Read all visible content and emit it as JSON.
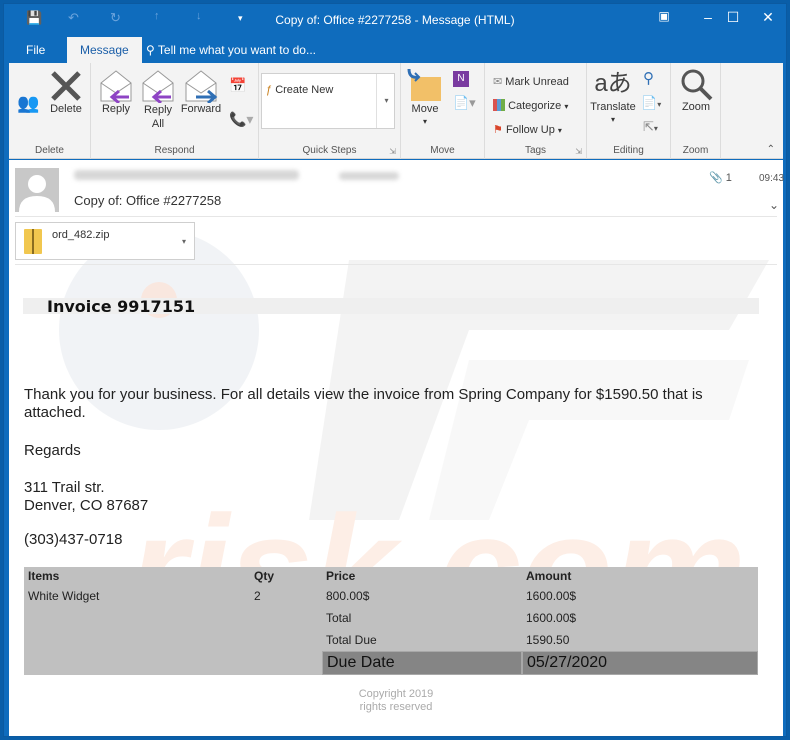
{
  "window": {
    "title": "Copy of: Office #2277258 - Message (HTML)",
    "quick_access": [
      "save-icon",
      "undo-icon",
      "redo-icon",
      "up-icon",
      "down-icon",
      "customize-icon"
    ],
    "controls": [
      "ribbon-display-icon",
      "minimize-icon",
      "maximize-icon",
      "close-icon"
    ]
  },
  "tabs": {
    "file": "File",
    "message": "Message",
    "tell_me": "Tell me what you want to do..."
  },
  "ribbon": {
    "groups": {
      "delete": "Delete",
      "respond": "Respond",
      "quick_steps": "Quick Steps",
      "move": "Move",
      "tags": "Tags",
      "editing": "Editing",
      "zoom": "Zoom"
    },
    "buttons": {
      "delete": "Delete",
      "reply": "Reply",
      "reply_all_1": "Reply",
      "reply_all_2": "All",
      "forward": "Forward",
      "create_new": "Create New",
      "move": "Move",
      "mark_unread": "Mark Unread",
      "categorize": "Categorize",
      "follow_up": "Follow Up",
      "translate": "Translate",
      "zoom": "Zoom"
    }
  },
  "message": {
    "subject": "Copy of: Office #2277258",
    "attachment_count": "1",
    "time": "09:43",
    "attachment": "ord_482.zip"
  },
  "body": {
    "invoice_title": "Invoice 9917151",
    "paragraph_1": "Thank you for your business. For all details view the invoice from Spring Company for $1590.50 that is",
    "paragraph_2": "attached.",
    "regards": "Regards",
    "address_1": "311 Trail str.",
    "address_2": "Denver, CO 87687",
    "phone": "(303)437-0718",
    "table": {
      "headers": [
        "Items",
        "Qty",
        "Price",
        "Amount"
      ],
      "item": {
        "name": "White Widget",
        "qty": "2",
        "price": "800.00$",
        "amount": "1600.00$"
      },
      "total_label": "Total",
      "total_value": "1600.00$",
      "total_due_label": "Total Due",
      "total_due_value": "1590.50",
      "due_date_label": "Due Date",
      "due_date_value": "05/27/2020"
    },
    "copyright_1": "Copyright  2019",
    "copyright_2": "rights reserved"
  },
  "colors": {
    "accent": "#0f6cbd",
    "table_bg": "#c0c0c0",
    "due_bg": "#858585"
  }
}
